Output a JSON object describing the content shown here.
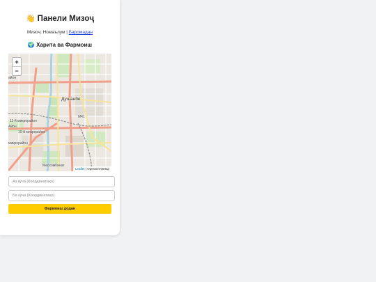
{
  "header": {
    "emoji": "👋",
    "title": "Панели Мизоҷ"
  },
  "user": {
    "label": "Мизоҷ: Номаълум |",
    "logout": "Баромадан"
  },
  "map_section": {
    "emoji": "🌍",
    "title": "Харита ва Фармоиш"
  },
  "map": {
    "zoom_in": "+",
    "zoom_out": "−",
    "city_label": "Душанбе",
    "labels": [
      "айон",
      "11-й микрорайон",
      "10-й микрорайон",
      "микрорайон",
      "Месхомбинат",
      "Айон",
      "М41"
    ],
    "attribution_leaflet": "Leaflet",
    "attribution_sep": " | ",
    "attribution_osm": "OpenStreetMap"
  },
  "form": {
    "from_placeholder": "Аз кӯча (Координатаҳо)",
    "to_placeholder": "Ба кӯча (Координатаҳо)",
    "submit_label": "Фармоиш додан"
  },
  "colors": {
    "accent": "#ffcc00",
    "link": "#1a3fd6",
    "page_bg": "#f1f2f4"
  }
}
